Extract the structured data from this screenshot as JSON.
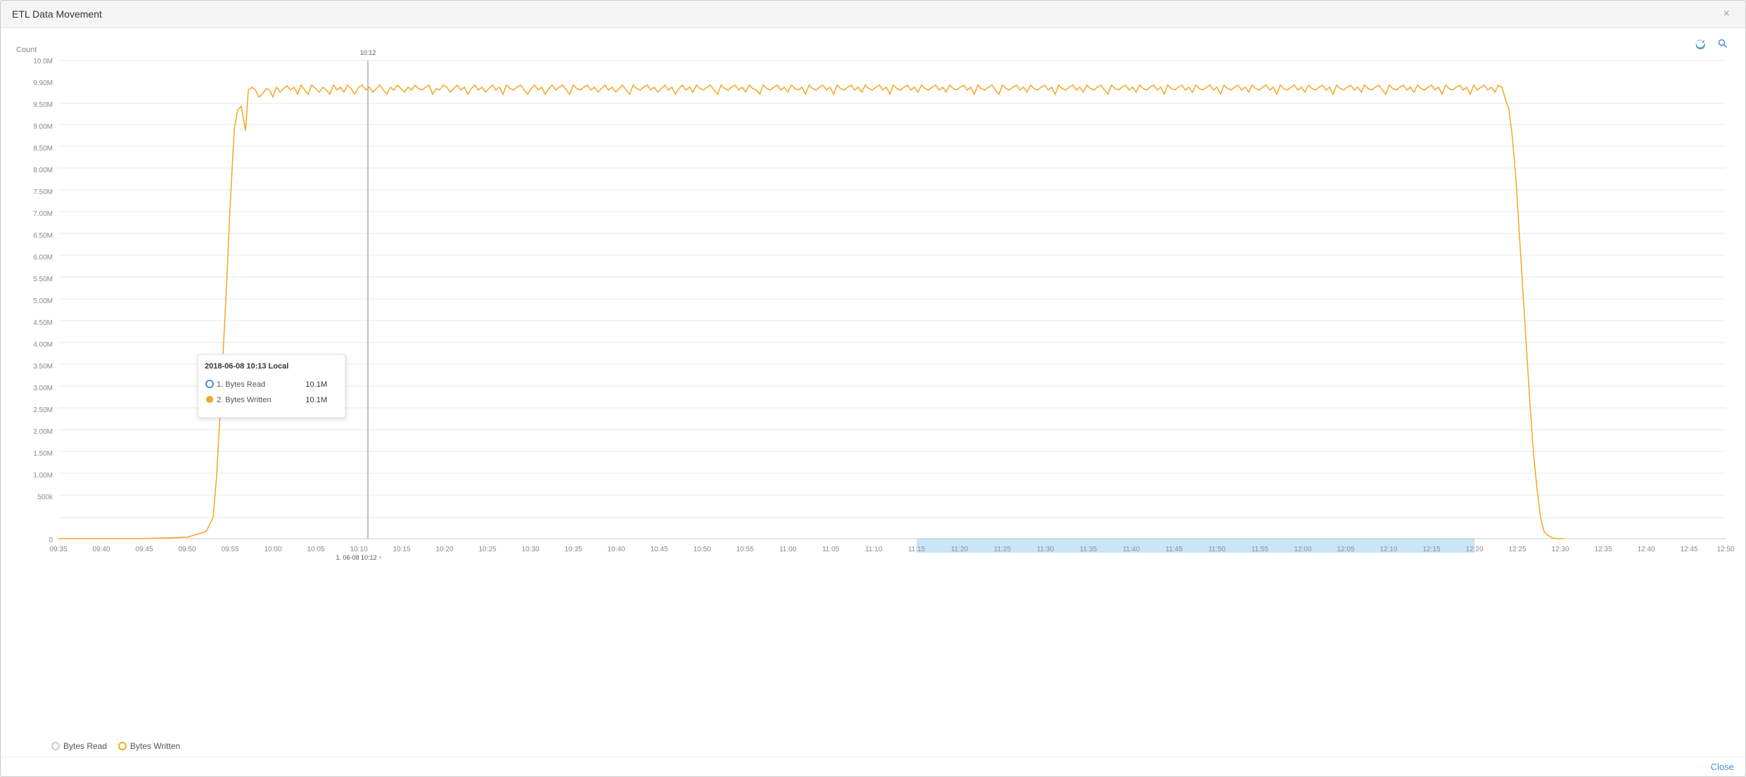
{
  "window": {
    "title": "ETL Data Movement",
    "close_label": "×"
  },
  "toolbar": {
    "refresh_label": "↻",
    "search_label": "🔍"
  },
  "chart": {
    "y_axis_label": "Count",
    "y_ticks": [
      "10.0M",
      "9.90M",
      "9.50M",
      "9.00M",
      "8.50M",
      "8.00M",
      "7.50M",
      "7.00M",
      "6.50M",
      "6.00M",
      "5.50M",
      "5.00M",
      "4.50M",
      "4.00M",
      "3.50M",
      "3.00M",
      "2.50M",
      "2.00M",
      "1.50M",
      "1.00M",
      "500k",
      "0"
    ],
    "x_ticks": [
      "09:35",
      "09:40",
      "09:45",
      "09:50",
      "09:55",
      "10:00",
      "10:05",
      "10:10",
      "10:15",
      "10:20",
      "10:25",
      "10:30",
      "10:35",
      "10:40",
      "10:45",
      "10:50",
      "10:55",
      "11:00",
      "11:05",
      "11:10",
      "11:15",
      "11:20",
      "11:25",
      "11:30",
      "11:35",
      "11:40",
      "11:45",
      "11:50",
      "11:55",
      "12:00",
      "12:05",
      "12:10",
      "12:15",
      "12:20",
      "12:25",
      "12:30",
      "12:35",
      "12:40",
      "12:45",
      "12:50"
    ],
    "line_color_read": "#cccccc",
    "line_color_written": "#f5a623",
    "vertical_line_x_label": "10:12"
  },
  "tooltip": {
    "title": "2018-06-08 10:13 Local",
    "row1_num": "1.",
    "row1_label": "Bytes Read",
    "row1_value": "10.1M",
    "row2_num": "2.",
    "row2_label": "Bytes Written",
    "row2_value": "10.1M"
  },
  "legend": {
    "item1_label": "Bytes Read",
    "item2_label": "Bytes Written"
  },
  "footer": {
    "close_label": "Close"
  }
}
